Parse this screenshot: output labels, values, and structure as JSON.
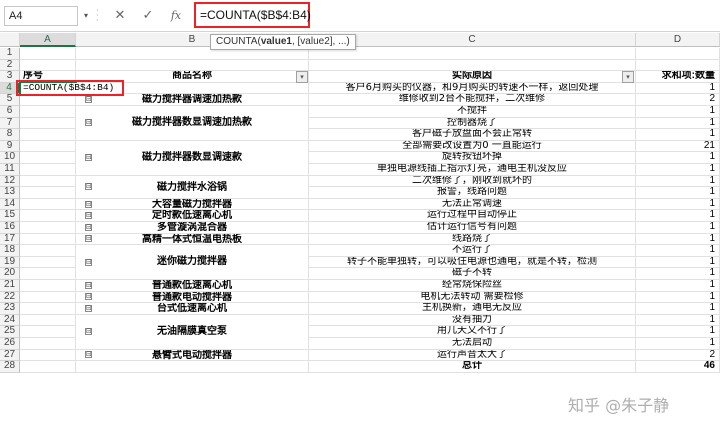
{
  "formula_bar": {
    "name_box": "A4",
    "cancel_icon": "✕",
    "enter_icon": "✓",
    "fx_label": "fx",
    "formula": "=COUNTA($B$4:B4)"
  },
  "tooltip": {
    "fn": "COUNTA(",
    "arg1": "value1",
    "rest": ", [value2], ...)"
  },
  "columns": [
    "A",
    "B",
    "C",
    "D"
  ],
  "selected_column": "A",
  "header_row": {
    "a": "序号",
    "b": "商品名称",
    "c": "实际原因",
    "d": "求和项:数量"
  },
  "active_cell_text": "=COUNTA($B$4:B4)",
  "rows": [
    {
      "n": "1"
    },
    {
      "n": "2"
    },
    {
      "n": "3"
    },
    {
      "n": "4",
      "c": "客户6月购买的仪器，和9月购买的转速不一样，返回处理",
      "d": "1"
    },
    {
      "n": "5",
      "c": "维修收到2台不能搅拌，二次维修",
      "d": "2"
    },
    {
      "n": "6",
      "c": "不搅拌",
      "d": "1"
    },
    {
      "n": "7",
      "c": "控制器烧了",
      "d": "1"
    },
    {
      "n": "8",
      "c": "客户磁子放盘面不会正常转",
      "d": "1"
    },
    {
      "n": "9",
      "c": "全部需要改设置为0 一直能运行",
      "d": "21"
    },
    {
      "n": "10",
      "c": "旋转按钮坏掉",
      "d": "1"
    },
    {
      "n": "11",
      "c": "单独电源线插上指示灯亮，通电主机没反应",
      "d": "1"
    },
    {
      "n": "12",
      "c": "二次维修了，刚收到就坏的",
      "d": "1"
    },
    {
      "n": "13",
      "c": "报警，线路问题",
      "d": "1"
    },
    {
      "n": "14",
      "c": "无法正常调速",
      "d": "1"
    },
    {
      "n": "15",
      "c": "运行过程中自动停止",
      "d": "1"
    },
    {
      "n": "16",
      "c": "估计运行信号有问题",
      "d": "1"
    },
    {
      "n": "17",
      "c": "线路烧了",
      "d": "1"
    },
    {
      "n": "18",
      "c": "不运行了",
      "d": "1"
    },
    {
      "n": "19",
      "c": "转子不能单独转，可以吸住电源也通电，就是不转，检测",
      "d": "1"
    },
    {
      "n": "20",
      "c": "磁子不转",
      "d": "1"
    },
    {
      "n": "21",
      "c": "经常烧保险丝",
      "d": "1"
    },
    {
      "n": "22",
      "c": "电机无法转动 需要检修",
      "d": "1"
    },
    {
      "n": "23",
      "c": "主机换新，通电无反应",
      "d": "1"
    },
    {
      "n": "24",
      "c": "没有抽力",
      "d": "1"
    },
    {
      "n": "25",
      "c": "用几天又不行了",
      "d": "1"
    },
    {
      "n": "26",
      "c": "无法启动",
      "d": "1"
    },
    {
      "n": "27",
      "c": "运行声音太大了",
      "d": "2"
    },
    {
      "n": "28",
      "c": "总计",
      "d": "46"
    }
  ],
  "products": [
    "磁力搅拌器调速加热款",
    "磁力搅拌器数显调速加热款",
    "磁力搅拌器数显调速款",
    "磁力搅拌水浴锅",
    "大容量磁力搅拌器",
    "定时款低速离心机",
    "多管漩涡混合器",
    "高精一体式恒温电热板",
    "迷你磁力搅拌器",
    "普通款低速离心机",
    "普通款电动搅拌器",
    "台式低速离心机",
    "无油隔膜真空泵",
    "悬臂式电动搅拌器"
  ],
  "collapse_icon": "⊟",
  "filter_icon": "▾",
  "watermark": "知乎 @朱子静",
  "accent_color": "#217346",
  "highlight_color": "#e8232a"
}
